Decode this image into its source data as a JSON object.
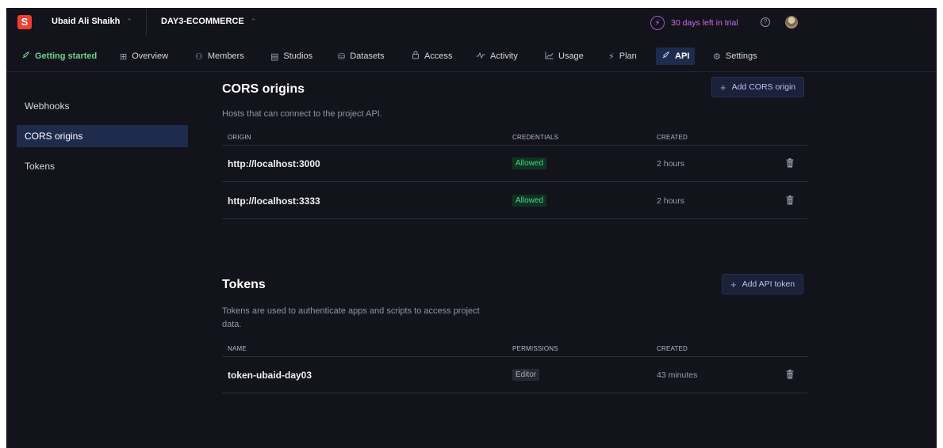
{
  "topbar": {
    "logo_letter": "S",
    "org_name": "Ubaid Ali Shaikh",
    "project_name": "DAY3-ECOMMERCE",
    "switch_glyph": "⌃",
    "trial_text": "30 days left in trial",
    "trial_icon": "⚡",
    "help_glyph": "?"
  },
  "nav": {
    "items": [
      {
        "label": "Getting started",
        "icon": "rocket-icon",
        "glyph": "🚀"
      },
      {
        "label": "Overview",
        "icon": "overview-icon",
        "glyph": "⊞"
      },
      {
        "label": "Members",
        "icon": "members-icon",
        "glyph": "⚇"
      },
      {
        "label": "Studios",
        "icon": "studios-icon",
        "glyph": "▤"
      },
      {
        "label": "Datasets",
        "icon": "datasets-icon",
        "glyph": "⛁"
      },
      {
        "label": "Access",
        "icon": "lock-icon",
        "glyph": "🔒"
      },
      {
        "label": "Activity",
        "icon": "activity-icon",
        "glyph": "⟋"
      },
      {
        "label": "Usage",
        "icon": "usage-icon",
        "glyph": "⟀"
      },
      {
        "label": "Plan",
        "icon": "plan-icon",
        "glyph": "⚡"
      },
      {
        "label": "API",
        "icon": "api-icon",
        "glyph": "⌁"
      },
      {
        "label": "Settings",
        "icon": "gear-icon",
        "glyph": "⚙"
      }
    ],
    "active": "API"
  },
  "sidebar": {
    "items": [
      {
        "label": "Webhooks"
      },
      {
        "label": "CORS origins"
      },
      {
        "label": "Tokens"
      }
    ],
    "active": "CORS origins"
  },
  "cors": {
    "title": "CORS origins",
    "description": "Hosts that can connect to the project API.",
    "add_label": "Add CORS origin",
    "columns": [
      "ORIGIN",
      "CREDENTIALS",
      "CREATED"
    ],
    "rows": [
      {
        "origin": "http://localhost:3000",
        "credentials": "Allowed",
        "created": "2 hours"
      },
      {
        "origin": "http://localhost:3333",
        "credentials": "Allowed",
        "created": "2 hours"
      }
    ]
  },
  "tokens": {
    "title": "Tokens",
    "description": "Tokens are used to authenticate apps and scripts to access project data.",
    "add_label": "Add API token",
    "columns": [
      "NAME",
      "PERMISSIONS",
      "CREATED"
    ],
    "rows": [
      {
        "name": "token-ubaid-day03",
        "permissions": "Editor",
        "created": "43 minutes"
      }
    ]
  },
  "colors": {
    "background": "#13141b",
    "accent": "#1f2b4d",
    "brand": "#f03e2f",
    "allowed_badge": "#4fd18a",
    "trial": "#c86ef0",
    "getting_started": "#6fd38f"
  }
}
